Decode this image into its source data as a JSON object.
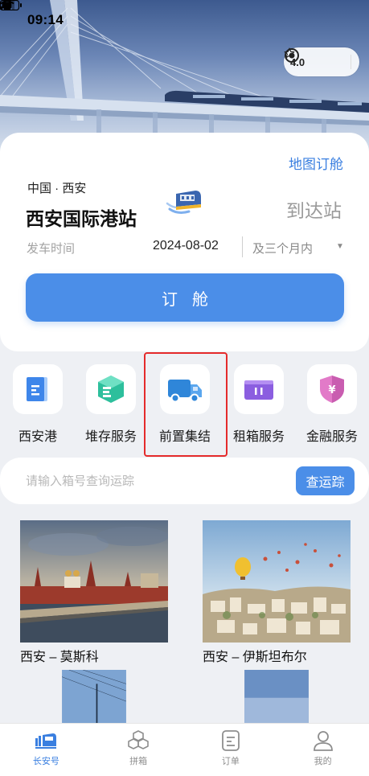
{
  "status_bar": {
    "time": "09:14"
  },
  "capsule": {
    "rating": "4.0"
  },
  "booking": {
    "map_link": "地图订舱",
    "from_region": "中国 · 西安",
    "from_station": "西安国际港站",
    "to_station": "到达站",
    "depart_label": "发车时间",
    "depart_date": "2024-08-02",
    "depart_range": "及三个月内",
    "book_button": "订舱"
  },
  "services": [
    {
      "label": "西安港",
      "icon": "document-icon"
    },
    {
      "label": "堆存服务",
      "icon": "storage-box-icon"
    },
    {
      "label": "前置集结",
      "icon": "truck-icon"
    },
    {
      "label": "租箱服务",
      "icon": "container-icon"
    },
    {
      "label": "金融服务",
      "icon": "finance-shield-icon"
    }
  ],
  "tracking": {
    "placeholder": "请输入箱号查询运踪",
    "button": "查运踪"
  },
  "routes": [
    {
      "name": "西安 – 莫斯科"
    },
    {
      "name": "西安 – 伊斯坦布尔"
    }
  ],
  "tabs": [
    {
      "label": "长安号",
      "active": true
    },
    {
      "label": "拼箱",
      "active": false
    },
    {
      "label": "订单",
      "active": false
    },
    {
      "label": "我的",
      "active": false
    }
  ],
  "colors": {
    "accent": "#4b8ee8",
    "link": "#3a7fe0",
    "highlight": "#e52b2b",
    "background": "#eef0f4"
  }
}
